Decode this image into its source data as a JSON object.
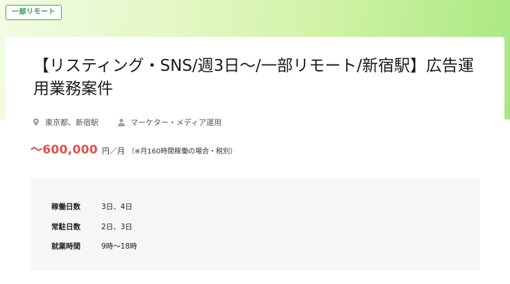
{
  "tag": {
    "label": "一部リモート"
  },
  "job": {
    "title": "【リスティング・SNS/週3日〜/一部リモート/新宿駅】広告運用業務案件",
    "location": "東京都、新宿駅",
    "category": "マーケター・メディア運用"
  },
  "salary": {
    "amount": "〜600,000",
    "unit": "円／月",
    "note": "（※月160時間稼働の場合・税別）"
  },
  "details": [
    {
      "label": "稼働日数",
      "value": "3日、4日"
    },
    {
      "label": "常駐日数",
      "value": "2日、3日"
    },
    {
      "label": "就業時間",
      "value": "9時〜18時"
    }
  ],
  "colors": {
    "accent_green": "#3aa65a",
    "salary_red": "#e0504a",
    "detail_bg": "#f5f6f7"
  },
  "icons": {
    "location": "map-pin-icon",
    "category": "person-icon"
  }
}
